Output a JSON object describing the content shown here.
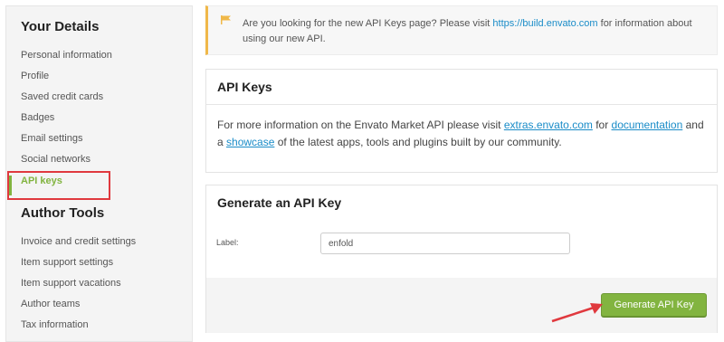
{
  "sidebar": {
    "your_details_heading": "Your Details",
    "your_details_items": [
      "Personal information",
      "Profile",
      "Saved credit cards",
      "Badges",
      "Email settings",
      "Social networks",
      "API keys"
    ],
    "author_tools_heading": "Author Tools",
    "author_tools_items": [
      "Invoice and credit settings",
      "Item support settings",
      "Item support vacations",
      "Author teams",
      "Tax information"
    ]
  },
  "notice": {
    "text_before": "Are you looking for the new API Keys page? Please visit ",
    "link": "https://build.envato.com",
    "text_after": " for information about using our new API.",
    "icon": "flag-icon",
    "accent_color": "#f0b849"
  },
  "api_keys_panel": {
    "title": "API Keys",
    "body_1": "For more information on the Envato Market API please visit ",
    "link_extras": "extras.envato.com",
    "body_2": " for ",
    "link_documentation": "documentation",
    "body_3": " and a ",
    "link_showcase": "showcase",
    "body_4": " of the latest apps, tools and plugins built by our community."
  },
  "generate_panel": {
    "title": "Generate an API Key",
    "label": "Label:",
    "input_value": "enfold",
    "button_label": "Generate API Key"
  },
  "colors": {
    "brand_green": "#82b440",
    "link_blue": "#1a8cc8",
    "annotation_red": "#e0393e"
  }
}
